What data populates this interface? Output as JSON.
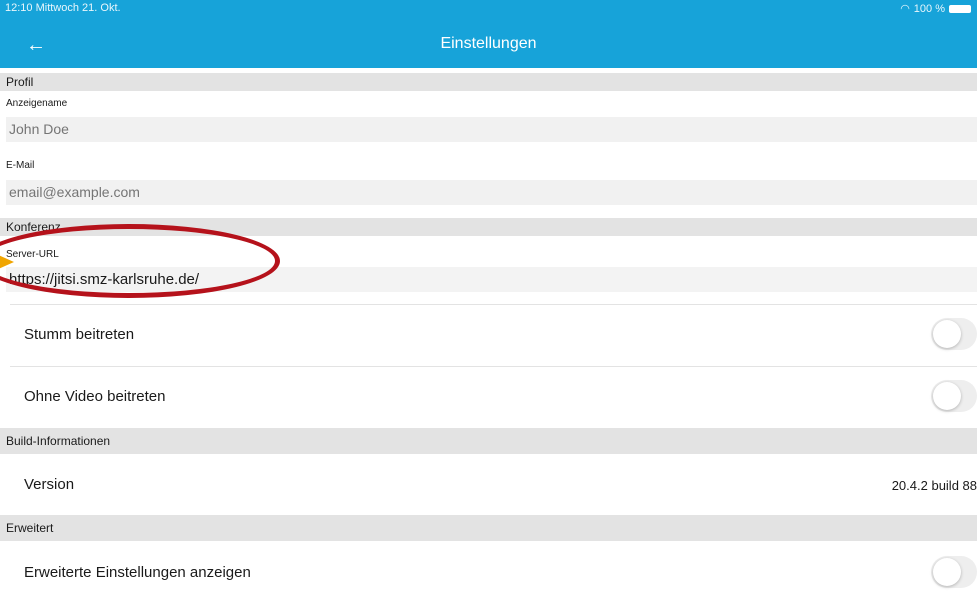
{
  "status_bar": {
    "time": "12:10  Mittwoch 21. Okt.",
    "wifi_icon": "wifi-icon",
    "battery": "100 %"
  },
  "header": {
    "back_icon": "arrow-left-icon",
    "back_glyph": "←",
    "title": "Einstellungen",
    "background": "#17a3d9"
  },
  "profile": {
    "section_title": "Profil",
    "display_name_label": "Anzeigename",
    "display_name_placeholder": "John Doe",
    "email_label": "E-Mail",
    "email_placeholder": "email@example.com"
  },
  "conference": {
    "section_title": "Konferenz",
    "server_url_label": "Server-URL",
    "server_url_value": "https://jitsi.smz-karlsruhe.de/",
    "join_muted_label": "Stumm beitreten",
    "join_muted_on": false,
    "join_no_video_label": "Ohne Video beitreten",
    "join_no_video_on": false
  },
  "build_info": {
    "section_title": "Build-Informationen",
    "version_label": "Version",
    "version_value": "20.4.2 build 88"
  },
  "advanced": {
    "section_title": "Erweitert",
    "show_advanced_label": "Erweiterte Einstellungen anzeigen",
    "show_advanced_on": false
  },
  "annotation": {
    "ellipse_color": "#b5121b",
    "arrow_color": "#f0a500"
  }
}
